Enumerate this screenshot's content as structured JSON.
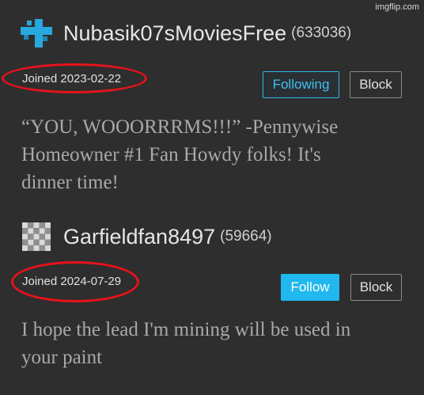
{
  "watermark": "imgflip.com",
  "users": [
    {
      "username": "Nubasik07sMoviesFree",
      "points": "(633036)",
      "avatar_icon": "pixel-cross-icon",
      "joined": "Joined 2023-02-22",
      "follow_label": "Following",
      "block_label": "Block",
      "bio_lines": [
        "“YOU, WOOORRRMS!!!” -Pennywise",
        "Homeowner #1 Fan Howdy folks! It's",
        "dinner time!"
      ]
    },
    {
      "username": "Garfieldfan8497",
      "points": "(59664)",
      "avatar_icon": "checkerboard-icon",
      "joined": "Joined 2024-07-29",
      "follow_label": "Follow",
      "block_label": "Block",
      "bio_lines": [
        "I hope the lead I'm mining will be used in",
        "your paint"
      ]
    }
  ],
  "colors": {
    "background": "#2e2e2e",
    "accent": "#20b8ee",
    "annotation": "#e8121b"
  }
}
